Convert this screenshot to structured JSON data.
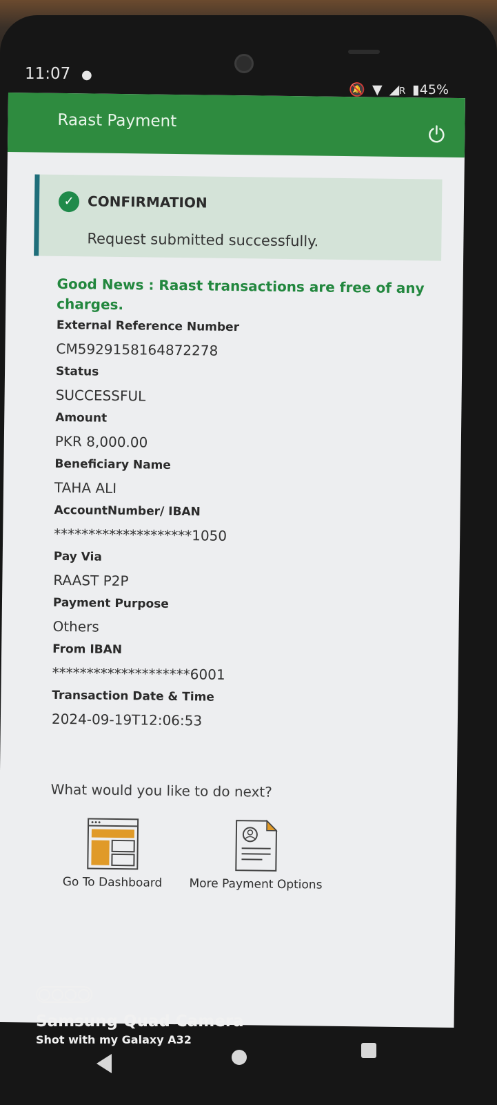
{
  "statusbar": {
    "time": "11:07",
    "battery": "45%",
    "network_label": "R"
  },
  "header": {
    "title": "Raast Payment",
    "power_icon": "power-icon"
  },
  "confirmation": {
    "title": "CONFIRMATION",
    "message": "Request submitted successfully.",
    "icon": "check-circle-icon"
  },
  "notice": "Good News : Raast transactions are free of any charges.",
  "details": [
    {
      "label": "External Reference Number",
      "value": "CM592915816487227​8"
    },
    {
      "label": "Status",
      "value": "SUCCESSFUL"
    },
    {
      "label": "Amount",
      "value": "PKR 8,000.00"
    },
    {
      "label": "Beneficiary Name",
      "value": "TAHA ALI"
    },
    {
      "label": "AccountNumber/ IBAN",
      "value": "********************1050"
    },
    {
      "label": "Pay Via",
      "value": "RAAST P2P"
    },
    {
      "label": "Payment Purpose",
      "value": "Others"
    },
    {
      "label": "From IBAN",
      "value": "********************6001"
    },
    {
      "label": "Transaction Date & Time",
      "value": "2024-09-19T12:06:53"
    }
  ],
  "next": {
    "question": "What would you like to do next?",
    "options": [
      {
        "label": "Go To Dashboard",
        "icon": "dashboard-icon"
      },
      {
        "label": "More Payment Options",
        "icon": "payment-document-icon"
      }
    ]
  },
  "camera_watermark": {
    "title": "Samsung Quad Camera",
    "subtitle": "Shot with my Galaxy A32"
  },
  "colors": {
    "header_green": "#2e8b3f",
    "notice_green": "#22873e",
    "confirm_bg": "#d4e3d8",
    "accent_teal": "#1f6e7a"
  }
}
